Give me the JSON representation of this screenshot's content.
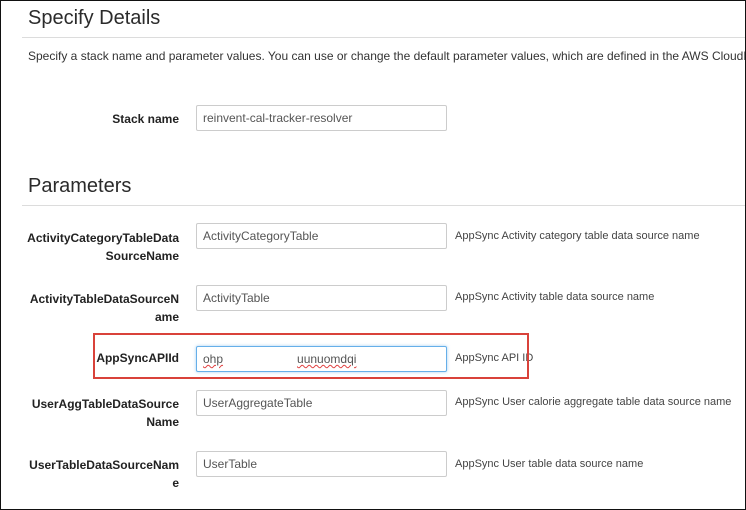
{
  "details": {
    "title": "Specify Details",
    "description": "Specify a stack name and parameter values. You can use or change the default parameter values, which are defined in the AWS CloudFo",
    "stack_name_label": "Stack name",
    "stack_name_value": "reinvent-cal-tracker-resolver"
  },
  "parameters": {
    "title": "Parameters",
    "fields": [
      {
        "label_line1": "ActivityCategoryTableData",
        "label_line2": "SourceName",
        "value": "ActivityCategoryTable",
        "hint": "AppSync Activity category table data source name"
      },
      {
        "label_line1": "ActivityTableDataSourceN",
        "label_line2": "ame",
        "value": "ActivityTable",
        "hint": "AppSync Activity table data source name"
      },
      {
        "label_line1": "AppSyncAPIId",
        "value_start": "ohp",
        "value_end": "uunuomdqi",
        "hint": "AppSync API ID"
      },
      {
        "label_line1": "UserAggTableDataSource",
        "label_line2": "Name",
        "value": "UserAggregateTable",
        "hint": "AppSync User calorie aggregate table data source name"
      },
      {
        "label_line1": "UserTableDataSourceNam",
        "label_line2": "e",
        "value": "UserTable",
        "hint": "AppSync User table data source name"
      }
    ]
  },
  "colors": {
    "highlight": "#d9423a",
    "focus_border": "#66afe9"
  }
}
